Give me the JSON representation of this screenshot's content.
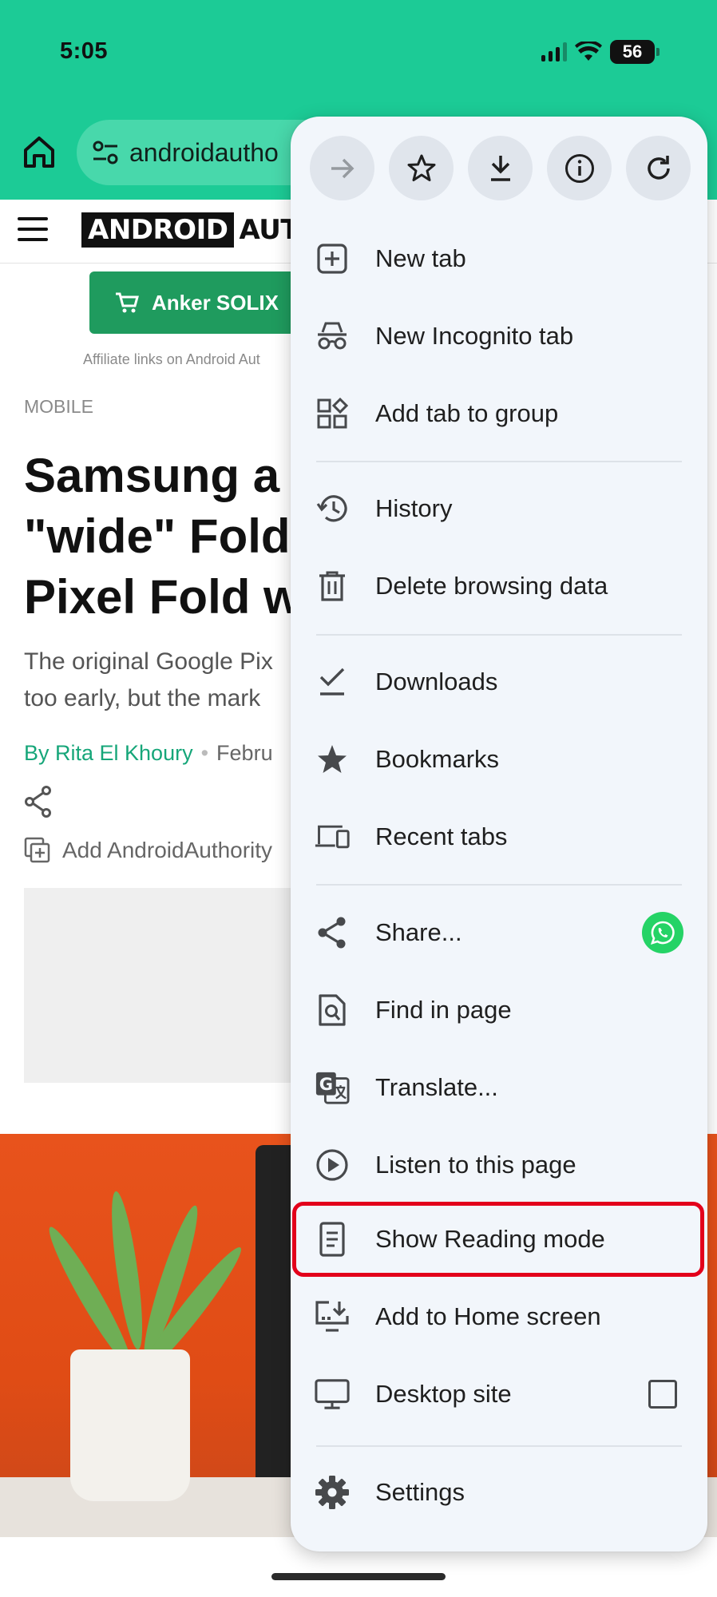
{
  "status_bar": {
    "time": "5:05",
    "battery": "56"
  },
  "toolbar": {
    "url": "androidautho"
  },
  "page": {
    "logo_dark": "ANDROID",
    "logo_light": "AUTHOR",
    "promo_label": "Anker SOLIX",
    "affiliate_note": "Affiliate links on Android Aut",
    "category": "MOBILE",
    "headline": "Samsung a\n\"wide\" Fold\nPixel Fold w",
    "subhead": "The original Google Pix\ntoo early, but the mark",
    "author": "By Rita El Khoury",
    "date": "Febru",
    "add_source": "Add AndroidAuthority"
  },
  "menu": {
    "top_buttons": [
      "forward-icon",
      "bookmark-star-icon",
      "download-icon",
      "info-icon",
      "refresh-icon"
    ],
    "items": [
      {
        "label": "New tab",
        "icon": "new-tab-icon"
      },
      {
        "label": "New Incognito tab",
        "icon": "incognito-icon"
      },
      {
        "label": "Add tab to group",
        "icon": "tab-group-icon"
      },
      {
        "label": "History",
        "icon": "history-icon"
      },
      {
        "label": "Delete browsing data",
        "icon": "trash-icon"
      },
      {
        "label": "Downloads",
        "icon": "downloads-check-icon"
      },
      {
        "label": "Bookmarks",
        "icon": "star-icon"
      },
      {
        "label": "Recent tabs",
        "icon": "devices-icon"
      },
      {
        "label": "Share...",
        "icon": "share-icon"
      },
      {
        "label": "Find in page",
        "icon": "find-in-page-icon"
      },
      {
        "label": "Translate...",
        "icon": "translate-icon"
      },
      {
        "label": "Listen to this page",
        "icon": "play-circle-icon"
      },
      {
        "label": "Show Reading mode",
        "icon": "reading-mode-icon"
      },
      {
        "label": "Add to Home screen",
        "icon": "add-to-home-icon"
      },
      {
        "label": "Desktop site",
        "icon": "desktop-icon"
      },
      {
        "label": "Settings",
        "icon": "settings-gear-icon"
      }
    ],
    "highlighted_item": "Show Reading mode",
    "desktop_site_checked": false
  },
  "colors": {
    "toolbar_green": "#1ccb96",
    "menu_bg": "#f2f6fb",
    "highlight_red": "#e3001b",
    "whatsapp_green": "#25d366",
    "author_green": "#16a679"
  }
}
